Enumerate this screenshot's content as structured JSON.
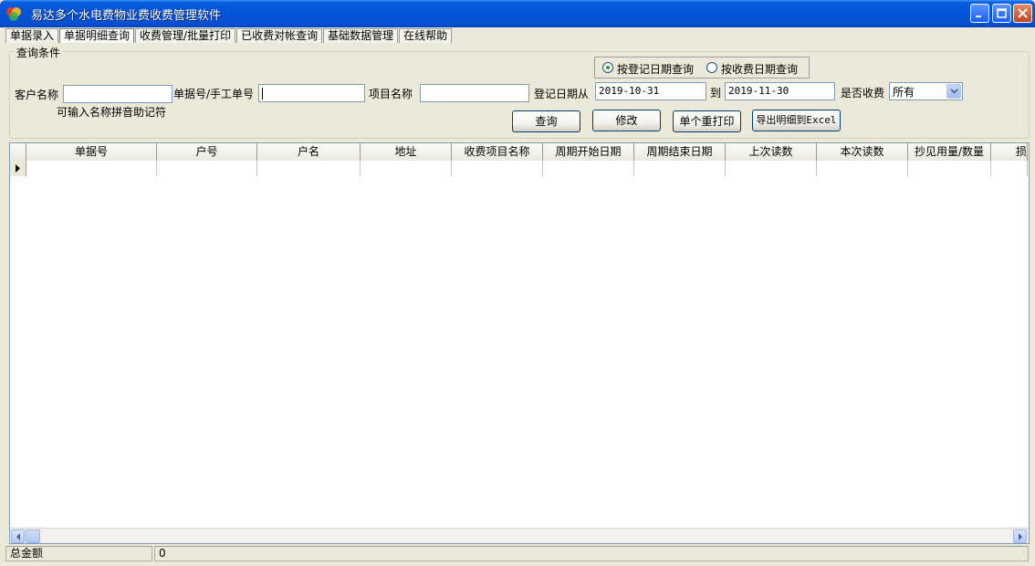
{
  "window": {
    "title": "易达多个水电费物业费收费管理软件",
    "icon": "app-logo-icon"
  },
  "menu": {
    "tabs": [
      {
        "label": "单据录入"
      },
      {
        "label": "单据明细查询"
      },
      {
        "label": "收费管理/批量打印"
      },
      {
        "label": "已收费对帐查询"
      },
      {
        "label": "基础数据管理"
      },
      {
        "label": "在线帮助"
      }
    ],
    "active_index": 1
  },
  "query": {
    "group_title": "查询条件",
    "radio_register": "按登记日期查询",
    "radio_charge": "按收费日期查询",
    "selected_radio": "register",
    "customer_label": "客户名称",
    "customer_value": "",
    "customer_hint": "可输入名称拼音助记符",
    "bill_no_label": "单据号/手工单号",
    "bill_no_value": "",
    "item_label": "项目名称",
    "item_value": "",
    "date_from_label": "登记日期从",
    "date_from": "2019-10-31",
    "date_to_label": "到",
    "date_to": "2019-11-30",
    "charged_label": "是否收费",
    "charged_value": "所有"
  },
  "buttons": {
    "query": "查询",
    "edit": "修改",
    "reprint": "单个重打印",
    "export": "导出明细到Excel"
  },
  "grid": {
    "columns": [
      "单据号",
      "户号",
      "户名",
      "地址",
      "收费项目名称",
      "周期开始日期",
      "周期结束日期",
      "上次读数",
      "本次读数",
      "抄见用量/数量",
      "损"
    ]
  },
  "status": {
    "total_label": "总金额",
    "total_value": "0"
  }
}
